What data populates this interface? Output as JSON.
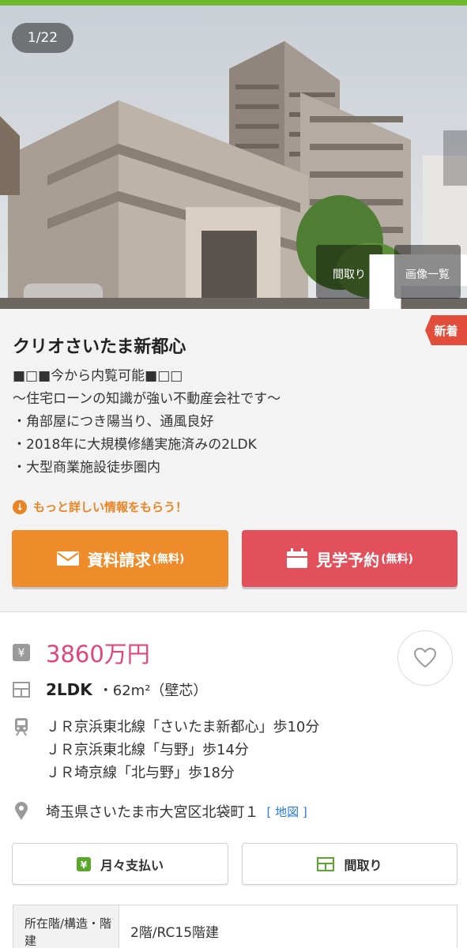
{
  "gallery": {
    "counter": "1/22",
    "floorplan_label": "間取り",
    "images_label": "画像一覧"
  },
  "listing": {
    "badge": "新着",
    "name": "クリオさいたま新都心",
    "pr_lines": [
      "■□■今から内覧可能■□□",
      "～住宅ローンの知識が強い不動産会社です～",
      "・角部屋につき陽当り、通風良好",
      "・2018年に大規模修繕実施済みの2LDK",
      "・大型商業施設徒歩圏内"
    ],
    "more_info_link": "もっと詳しい情報をもらう！",
    "request_button": {
      "label": "資料請求",
      "note": "(無料)"
    },
    "visit_button": {
      "label": "見学予約",
      "note": "(無料)"
    }
  },
  "details": {
    "price": "3860万円",
    "layout": "2LDK",
    "area": "・62m²（壁芯）",
    "stations": [
      "ＪＲ京浜東北線「さいたま新都心」歩10分",
      "ＪＲ京浜東北線「与野」歩14分",
      "ＪＲ埼京線「北与野」歩18分"
    ],
    "address": "埼玉県さいたま市大宮区北袋町１",
    "map_link": "[ 地図 ]",
    "monthly_button": "月々支払い",
    "floorplan_button": "間取り",
    "table": {
      "header": "所在階/構造・階建",
      "value": "2階/RC15階建"
    }
  },
  "colors": {
    "brand_green": "#6fba2c",
    "price_pink": "#e0457b",
    "request_orange": "#ee8c2c",
    "visit_red": "#e1505b",
    "new_badge": "#e14d3a",
    "link_blue": "#2a7ad6"
  }
}
